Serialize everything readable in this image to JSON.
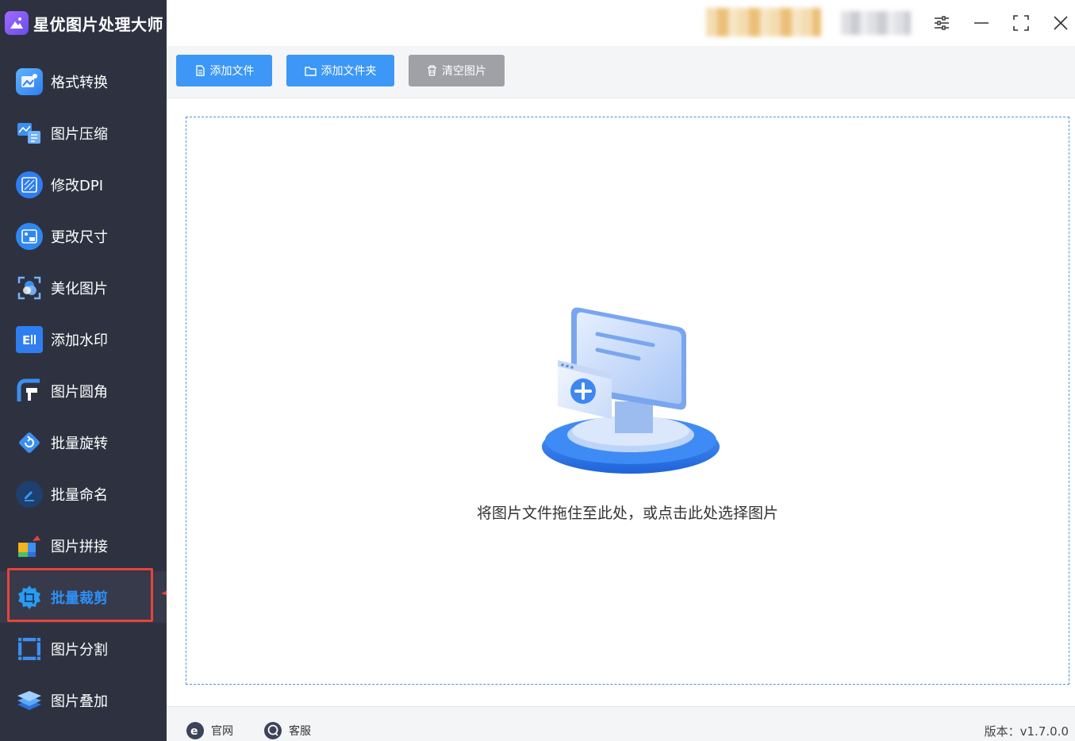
{
  "app": {
    "title": "星优图片处理大师"
  },
  "sidebar": {
    "items": [
      {
        "label": "格式转换",
        "icon": "format-convert-icon",
        "active": false
      },
      {
        "label": "图片压缩",
        "icon": "compress-icon",
        "active": false
      },
      {
        "label": "修改DPI",
        "icon": "dpi-icon",
        "active": false
      },
      {
        "label": "更改尺寸",
        "icon": "resize-icon",
        "active": false
      },
      {
        "label": "美化图片",
        "icon": "beautify-icon",
        "active": false
      },
      {
        "label": "添加水印",
        "icon": "watermark-icon",
        "active": false
      },
      {
        "label": "图片圆角",
        "icon": "round-corner-icon",
        "active": false
      },
      {
        "label": "批量旋转",
        "icon": "rotate-icon",
        "active": false
      },
      {
        "label": "批量命名",
        "icon": "rename-icon",
        "active": false
      },
      {
        "label": "图片拼接",
        "icon": "stitch-icon",
        "active": false
      },
      {
        "label": "批量裁剪",
        "icon": "crop-icon",
        "active": true
      },
      {
        "label": "图片分割",
        "icon": "split-icon",
        "active": false
      },
      {
        "label": "图片叠加",
        "icon": "overlay-icon",
        "active": false
      }
    ]
  },
  "toolbar": {
    "add_file": "添加文件",
    "add_folder": "添加文件夹",
    "clear_images": "清空图片"
  },
  "dropzone": {
    "hint": "将图片文件拖住至此处，或点击此处选择图片"
  },
  "footer": {
    "website": "官网",
    "support": "客服",
    "version": "版本：v1.7.0.0"
  },
  "colors": {
    "accent": "#3c97f6",
    "sidebar_bg": "#2e3240",
    "annotation": "#e8433c"
  }
}
